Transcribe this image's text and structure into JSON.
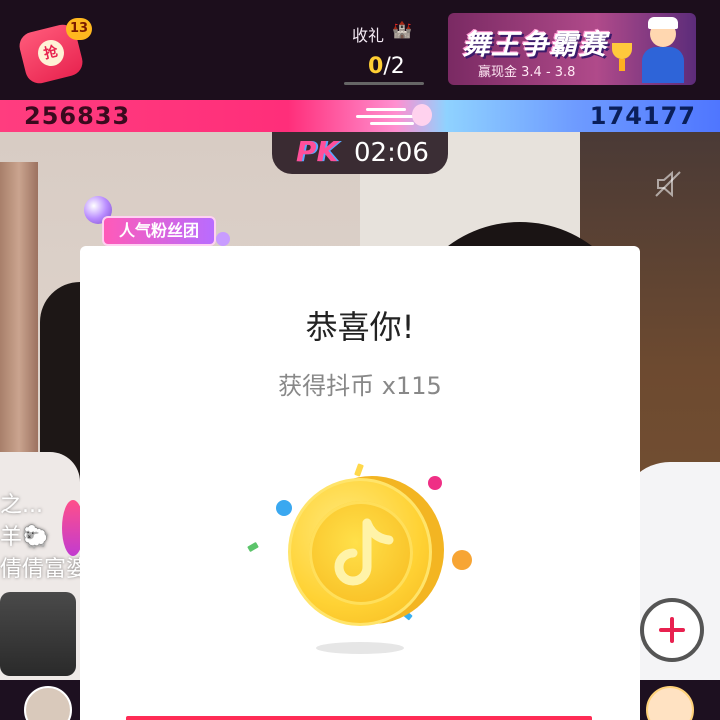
{
  "top": {
    "red_packet": {
      "seal": "抢",
      "badge": "13"
    },
    "gift": {
      "title": "收礼",
      "icon": "castle-icon",
      "received": "0",
      "total": "/2"
    },
    "banner": {
      "title": "舞王争霸赛",
      "subtitle": "赢现金 3.4 - 3.8"
    }
  },
  "pk": {
    "score_left": "256833",
    "score_right": "174177",
    "logo": "PK",
    "timer": "02:06",
    "colors": {
      "left": "#ff2e7a",
      "right": "#4f76ff"
    }
  },
  "stage": {
    "fan_badge": "人气粉丝团",
    "side_comments": [
      "之...",
      "羊🐑",
      "倩倩富婆"
    ]
  },
  "modal": {
    "title": "恭喜你!",
    "subtitle": "获得抖币 x115",
    "coin_icon": "douyin-coin-icon",
    "accent": "#ff2c55"
  }
}
